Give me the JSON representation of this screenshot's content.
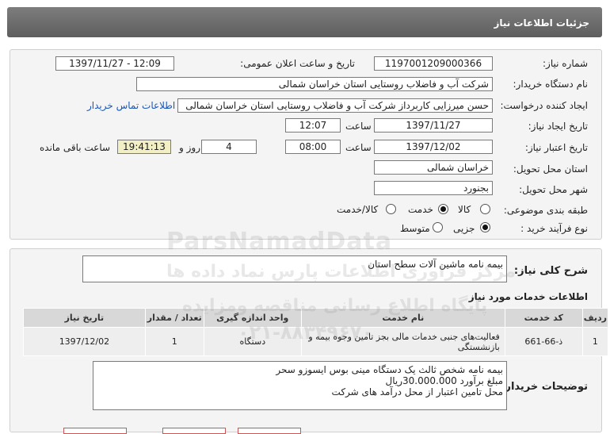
{
  "header": {
    "title": "جزئیات اطلاعات نیاز"
  },
  "fields": {
    "need_number_label": "شماره نیاز:",
    "need_number": "1197001209000366",
    "announce_label": "تاریخ و ساعت اعلان عمومی:",
    "announce_value": "1397/11/27 - 12:09",
    "buyer_label": "نام دستگاه خریدار:",
    "buyer_value": "شرکت آب و فاضلاب روستایی استان خراسان شمالی",
    "requester_label": "ایجاد کننده درخواست:",
    "requester_value": "حسن  میرزایی کاربرداز شرکت آب و فاضلاب روستایی استان خراسان شمالی",
    "contact_link": "اطلاعات تماس خریدار",
    "create_date_label": "تاریخ ایجاد نیاز:",
    "create_date": "1397/11/27",
    "time_label": "ساعت",
    "create_time": "12:07",
    "validity_label": "تاریخ اعتبار نیاز:",
    "validity_date": "1397/12/02",
    "validity_time": "08:00",
    "days_value": "4",
    "days_label": "روز و",
    "remaining_time": "19:41:13",
    "remaining_label": "ساعت باقی مانده",
    "province_label": "استان محل تحویل:",
    "province_value": "خراسان شمالی",
    "city_label": "شهر محل تحویل:",
    "city_value": "بجنورد",
    "category_label": "طبقه بندی موضوعی:",
    "category_options": [
      "کالا",
      "خدمت",
      "کالا/خدمت"
    ],
    "process_label": "نوع فرآیند خرید :",
    "process_options": [
      "جزیی",
      "متوسط"
    ]
  },
  "summary": {
    "label": "شرح کلی نیاز:",
    "value": "بیمه نامه ماشین آلات سطح استان"
  },
  "services": {
    "section_title": "اطلاعات خدمات مورد نیاز",
    "headers": [
      "ردیف",
      "کد خدمت",
      "نام خدمت",
      "واحد اندازه گیری",
      "تعداد / مقدار",
      "تاریخ نیاز"
    ],
    "rows": [
      [
        "1",
        "ذ-66-661",
        "فعالیت‌های جنبی خدمات مالی بجز تامین وجوه بیمه و بازنشستگی",
        "دستگاه",
        "1",
        "1397/12/02"
      ]
    ]
  },
  "buyer_notes": {
    "label": "توضیحات خریدار:",
    "line1": "بیمه نامه شخص ثالث یک دستگاه مینی بوس ایسوزو  سحر",
    "line2": "مبلغ برآورد 30.000.000ریال",
    "line3": "محل تامین اعتبار از محل درآمد های شرکت"
  },
  "watermark": {
    "brand": "ParsNamadData",
    "line1": "مرکز فراوری اطلاعات پارس نماد داده ها",
    "line2": "پایگاه اطلاع رسانی مناقصه ومزایده",
    "phone": "۰۲۱-۸۸۳۴۹۶۷۰"
  },
  "colors": {
    "header_bg": "#6b6b6b",
    "panel_bg": "#f4f4f4",
    "link": "#1a56b8",
    "remaining_bg": "#f3efc4"
  }
}
